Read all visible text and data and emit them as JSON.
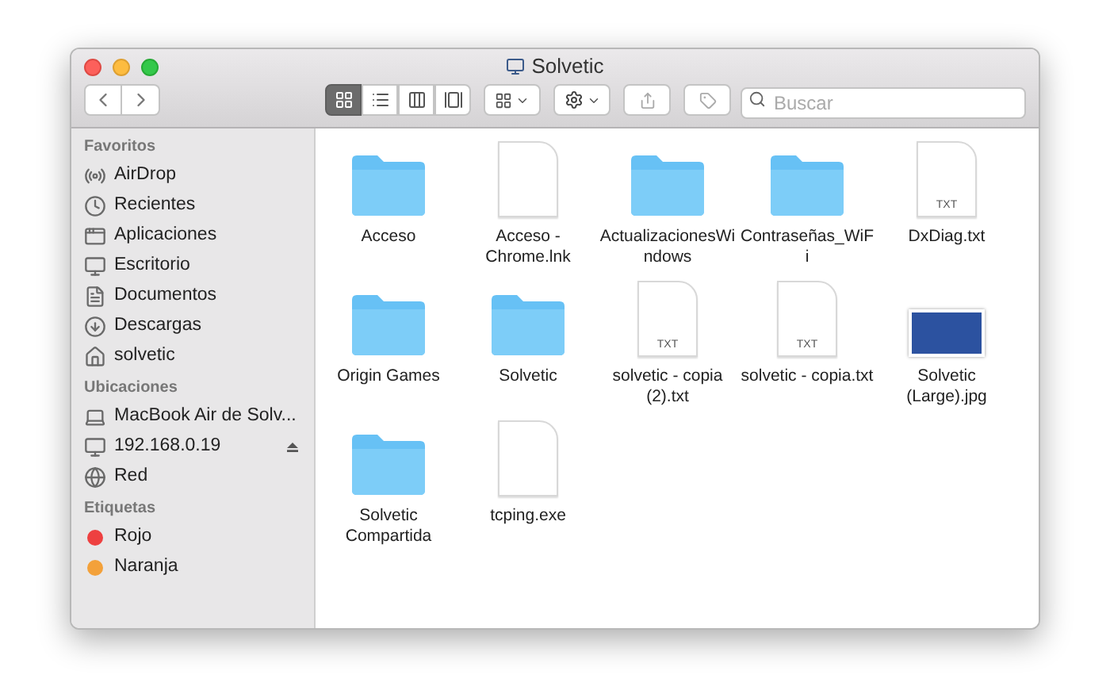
{
  "window": {
    "title": "Solvetic"
  },
  "toolbar": {
    "views": [
      {
        "kind": "icons",
        "selected": true
      },
      {
        "kind": "list",
        "selected": false
      },
      {
        "kind": "columns",
        "selected": false
      },
      {
        "kind": "gallery",
        "selected": false
      }
    ]
  },
  "search": {
    "placeholder": "Buscar"
  },
  "sidebar": {
    "sections": [
      {
        "heading": "Favoritos",
        "items": [
          {
            "label": "AirDrop",
            "kind": "airdrop"
          },
          {
            "label": "Recientes",
            "kind": "recents"
          },
          {
            "label": "Aplicaciones",
            "kind": "apps"
          },
          {
            "label": "Escritorio",
            "kind": "desktop"
          },
          {
            "label": "Documentos",
            "kind": "documents"
          },
          {
            "label": "Descargas",
            "kind": "downloads"
          },
          {
            "label": "solvetic",
            "kind": "home"
          }
        ]
      },
      {
        "heading": "Ubicaciones",
        "items": [
          {
            "label": "MacBook Air de Solv...",
            "kind": "laptop",
            "ejectable": false
          },
          {
            "label": "192.168.0.19",
            "kind": "display",
            "ejectable": true
          },
          {
            "label": "Red",
            "kind": "network",
            "ejectable": false
          }
        ]
      },
      {
        "heading": "Etiquetas",
        "items": [
          {
            "label": "Rojo",
            "kind": "tag",
            "color": "#ee4040"
          },
          {
            "label": "Naranja",
            "kind": "tag",
            "color": "#f3a13a"
          }
        ]
      }
    ]
  },
  "files": [
    {
      "name": "Acceso",
      "kind": "folder"
    },
    {
      "name": "Acceso - Chrome.lnk",
      "kind": "document"
    },
    {
      "name": "ActualizacionesWindows",
      "kind": "folder"
    },
    {
      "name": "Contraseñas_WiFi",
      "kind": "folder"
    },
    {
      "name": "DxDiag.txt",
      "kind": "text",
      "badge": "TXT"
    },
    {
      "name": "Origin Games",
      "kind": "folder"
    },
    {
      "name": "Solvetic",
      "kind": "folder"
    },
    {
      "name": "solvetic - copia (2).txt",
      "kind": "text",
      "badge": "TXT"
    },
    {
      "name": "solvetic - copia.txt",
      "kind": "text",
      "badge": "TXT"
    },
    {
      "name": "Solvetic (Large).jpg",
      "kind": "image"
    },
    {
      "name": "Solvetic Compartida",
      "kind": "folder"
    },
    {
      "name": "tcping.exe",
      "kind": "document"
    }
  ]
}
